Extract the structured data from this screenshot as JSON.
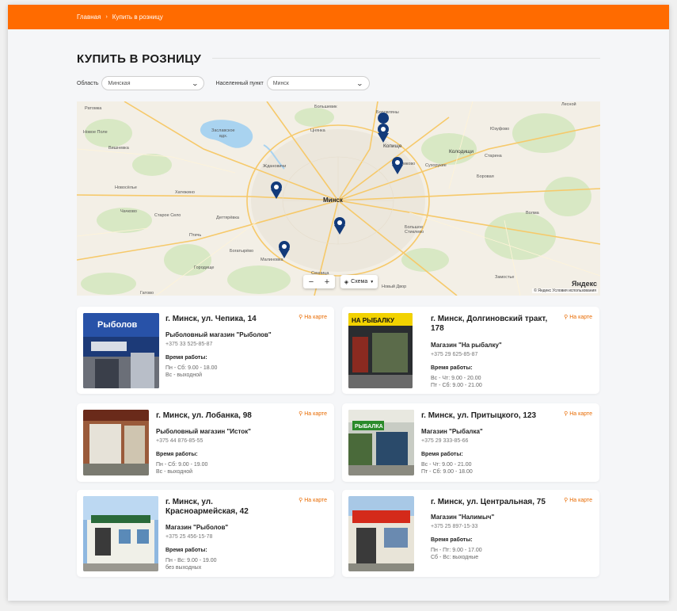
{
  "breadcrumb": {
    "home": "Главная",
    "separator": "›",
    "current": "Купить в розницу"
  },
  "page_title": "КУПИТЬ В РОЗНИЦУ",
  "filters": {
    "region_label": "Область",
    "region_value": "Минская",
    "city_label": "Населенный пункт",
    "city_value": "Минск"
  },
  "map": {
    "labels": [
      "Заславское вдх.",
      "Ждановичи",
      "Цнянка",
      "Боровляны",
      "Копище",
      "Колодищи",
      "Минск",
      "Новое Поле",
      "Вишневка",
      "Хатежино",
      "Новосёлье",
      "Старое Село",
      "Дегтярёвка",
      "Чачково",
      "Птичь",
      "Богатырёво",
      "Малиновка",
      "Городище",
      "Сенница",
      "Лесной",
      "Большевик",
      "Сухорукие",
      "Боровая",
      "Юзуфово",
      "Старина",
      "Волма",
      "Большое Стиклево",
      "Замостье",
      "Новый Двор",
      "Гатово",
      "Семково",
      "Ратомка",
      "Малиновка"
    ],
    "zoom_out": "−",
    "zoom_in": "+",
    "scheme_label": "Схема",
    "copyright": "© Яндекс  Условия использования",
    "logo": "Яндекс",
    "pin_color": "#123a7a"
  },
  "on_map_label": "На карте",
  "hours_title": "Время работы:",
  "stores": [
    {
      "address": "г. Минск, ул. Чепика, 14",
      "shop": "Рыболовный магазин \"Рыболов\"",
      "phone": "+375 33 525-85-87",
      "hours1": "Пн - Сб: 9.00 - 18.00",
      "hours2": "Вс - выходной",
      "sign": "Рыболов"
    },
    {
      "address": "г. Минск, Долгиновский тракт, 178",
      "shop": "Магазин \"На рыбалку\"",
      "phone": "+375 29 625-85-87",
      "hours1": "Вс - Чт: 9.00 - 20.00",
      "hours2": "Пт - Сб: 9.00 - 21.00",
      "sign": "НА РЫБАЛКУ"
    },
    {
      "address": "г. Минск, ул. Лобанка, 98",
      "shop": "Рыболовный магазин \"Исток\"",
      "phone": "+375 44 876-85-55",
      "hours1": "Пн - Сб: 9.00 - 19.00",
      "hours2": "Вс - выходной"
    },
    {
      "address": "г. Минск, ул. Притыцкого, 123",
      "shop": "Магазин \"Рыбалка\"",
      "phone": "+375 29 333-85-66",
      "hours1": "Вс - Чт: 9.00 - 21.00",
      "hours2": "Пт - Сб: 9.00 - 18.00",
      "sign": "РЫБАЛКА"
    },
    {
      "address_line1": "г. Минск, ул.",
      "address_line2": "Красноармейская, 42",
      "shop": "Магазин \"Рыболов\"",
      "phone": "+375 25 456-15-78",
      "hours1": "Пн - Вс: 9.00 - 19.00",
      "hours2": "без выходных"
    },
    {
      "address": "г. Минск, ул. Центральная, 75",
      "shop": "Магазин \"Налимыч\"",
      "phone": "+375 25 897-15-33",
      "hours1": "Пн - Пт: 9.00 - 17.00",
      "hours2": "Сб - Вс: выходные"
    }
  ]
}
